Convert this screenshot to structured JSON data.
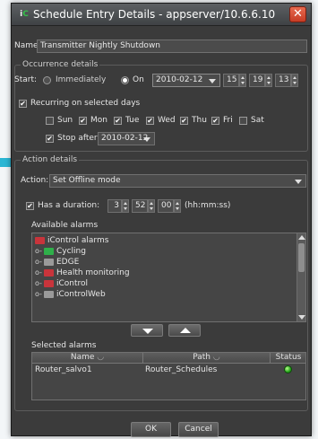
{
  "window": {
    "title": "Schedule Entry Details - appserver/10.6.6.10",
    "icon_name": "ic-app-icon"
  },
  "name_field": {
    "label": "Name:",
    "value": "Transmitter Nightly Shutdown"
  },
  "occurrence": {
    "group_title": "Occurrence details",
    "start_label": "Start:",
    "immediately_label": "Immediately",
    "on_label": "On",
    "selected_option": "On",
    "date": "2010-02-12",
    "hour": "15",
    "minute": "19",
    "second": "13",
    "recurring_label": "Recurring on selected days",
    "recurring_checked": true,
    "days": [
      {
        "label": "Sun",
        "checked": false
      },
      {
        "label": "Mon",
        "checked": true
      },
      {
        "label": "Tue",
        "checked": true
      },
      {
        "label": "Wed",
        "checked": true
      },
      {
        "label": "Thu",
        "checked": true
      },
      {
        "label": "Fri",
        "checked": true
      },
      {
        "label": "Sat",
        "checked": false
      }
    ],
    "stop_after_label": "Stop after",
    "stop_after_checked": true,
    "stop_after_date": "2010-02-12"
  },
  "action": {
    "group_title": "Action details",
    "action_label": "Action:",
    "action_value": "Set Offline mode",
    "duration_label": "Has a duration:",
    "duration_checked": true,
    "dur_hours": "3",
    "dur_minutes": "52",
    "dur_seconds": "00",
    "duration_format": "(hh:mm:ss)"
  },
  "available_alarms": {
    "label": "Available alarms",
    "items": [
      {
        "label": "iControl alarms",
        "folder_color": "#c8343b",
        "indent": 0,
        "expander": ""
      },
      {
        "label": "Cycling",
        "folder_color": "#2fb04a",
        "indent": 1,
        "expander": "o-"
      },
      {
        "label": "EDGE",
        "folder_color": "#9a9a9a",
        "indent": 1,
        "expander": "o-"
      },
      {
        "label": "Health monitoring",
        "folder_color": "#c8343b",
        "indent": 1,
        "expander": "o-"
      },
      {
        "label": "iControl",
        "folder_color": "#c8343b",
        "indent": 1,
        "expander": "o-"
      },
      {
        "label": "iControlWeb",
        "folder_color": "#9a9a9a",
        "indent": 1,
        "expander": "o-"
      }
    ]
  },
  "selected_alarms": {
    "label": "Selected alarms",
    "columns": [
      "Name",
      "Path",
      "Status"
    ],
    "rows": [
      {
        "name": "Router_salvo1",
        "path": "Router_Schedules",
        "status_color": "#25a41c"
      }
    ]
  },
  "buttons": {
    "ok": "OK",
    "cancel": "Cancel"
  },
  "colors": {
    "pointer_arrow": "#2bb6d4"
  }
}
